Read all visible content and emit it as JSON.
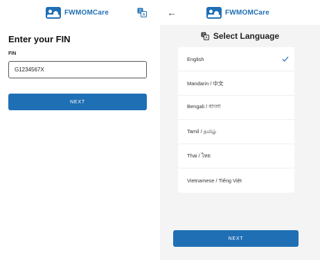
{
  "app": {
    "brand": "FWMOMCare"
  },
  "fin_screen": {
    "title": "Enter your FIN",
    "fin_label": "FIN",
    "fin_value": "G1234567X",
    "next_label": "NEXT"
  },
  "language_screen": {
    "title": "Select Language",
    "languages": [
      {
        "label": "English",
        "selected": true
      },
      {
        "label": "Mandarin / 中文",
        "selected": false
      },
      {
        "label": "Bengali / বাংলা",
        "selected": false
      },
      {
        "label": "Tamil / தமிழ்",
        "selected": false
      },
      {
        "label": "Thai / ไทย",
        "selected": false
      },
      {
        "label": "Vietnamese / Tiếng Việt",
        "selected": false
      }
    ],
    "next_label": "NEXT"
  },
  "colors": {
    "primary": "#1f6fb5",
    "panel_bg": "#f4f4f4",
    "check": "#1f6fb5"
  },
  "icons": {
    "translate": "translate-icon",
    "back": "back-arrow-icon",
    "check": "check-icon",
    "logo": "app-logo-icon"
  }
}
